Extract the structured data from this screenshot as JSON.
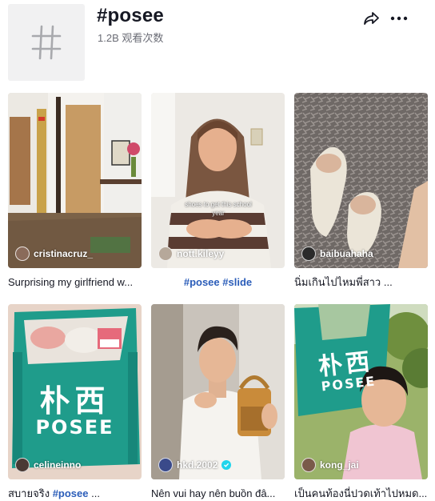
{
  "header": {
    "title": "#posee",
    "views": "1.2B 观看次数"
  },
  "videos": [
    {
      "user": "cristinacruz_",
      "caption": "Surprising my girlfriend w...",
      "verified": false
    },
    {
      "user": "nott.kileyy",
      "caption_tags": [
        "#posee",
        "#slide"
      ],
      "overlay": "shoes to get this school year",
      "verified": false
    },
    {
      "user": "baibuahaha",
      "caption": "นิ่มเกินไปไหมพี่สาว ...",
      "verified": false
    },
    {
      "user": "celineinno",
      "caption_text": "สบายจริง",
      "caption_tag": "#posee",
      "caption_end": "...",
      "verified": false
    },
    {
      "user": "hkd.2002",
      "caption": "Nên vui hay nên buồn đâ...",
      "verified": true
    },
    {
      "user": "kong_jai",
      "caption": "เป็นคนท้องนี่ปวดเท้าไปหมด...",
      "verified": false
    }
  ],
  "colors": {
    "accent_tag": "#2b5db9",
    "verified": "#20d5ec",
    "bag_green": "#1f9c8b"
  },
  "bag_text": {
    "cn": "朴西",
    "en": "POSEE"
  }
}
